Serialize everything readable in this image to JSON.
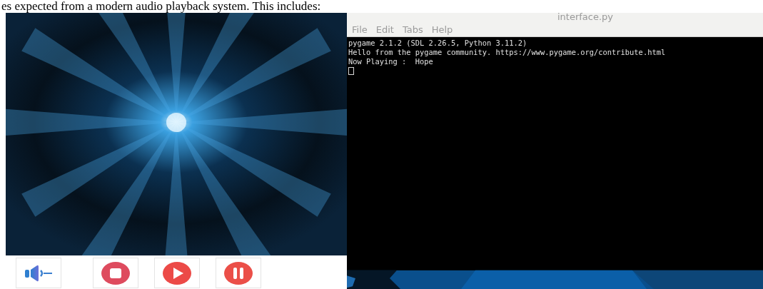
{
  "document_text": "es expected from a modern audio playback system. This includes:",
  "player": {
    "buttons": [
      {
        "kind": "volume"
      },
      {
        "kind": "stop"
      },
      {
        "kind": "play"
      },
      {
        "kind": "pause"
      }
    ]
  },
  "terminal": {
    "title": "interface.py",
    "menu": [
      "File",
      "Edit",
      "Tabs",
      "Help"
    ],
    "lines": [
      "pygame 2.1.2 (SDL 2.26.5, Python 3.11.2)",
      "Hello from the pygame community. https://www.pygame.org/contribute.html",
      "Now Playing :  Hope"
    ],
    "cursor": true
  }
}
